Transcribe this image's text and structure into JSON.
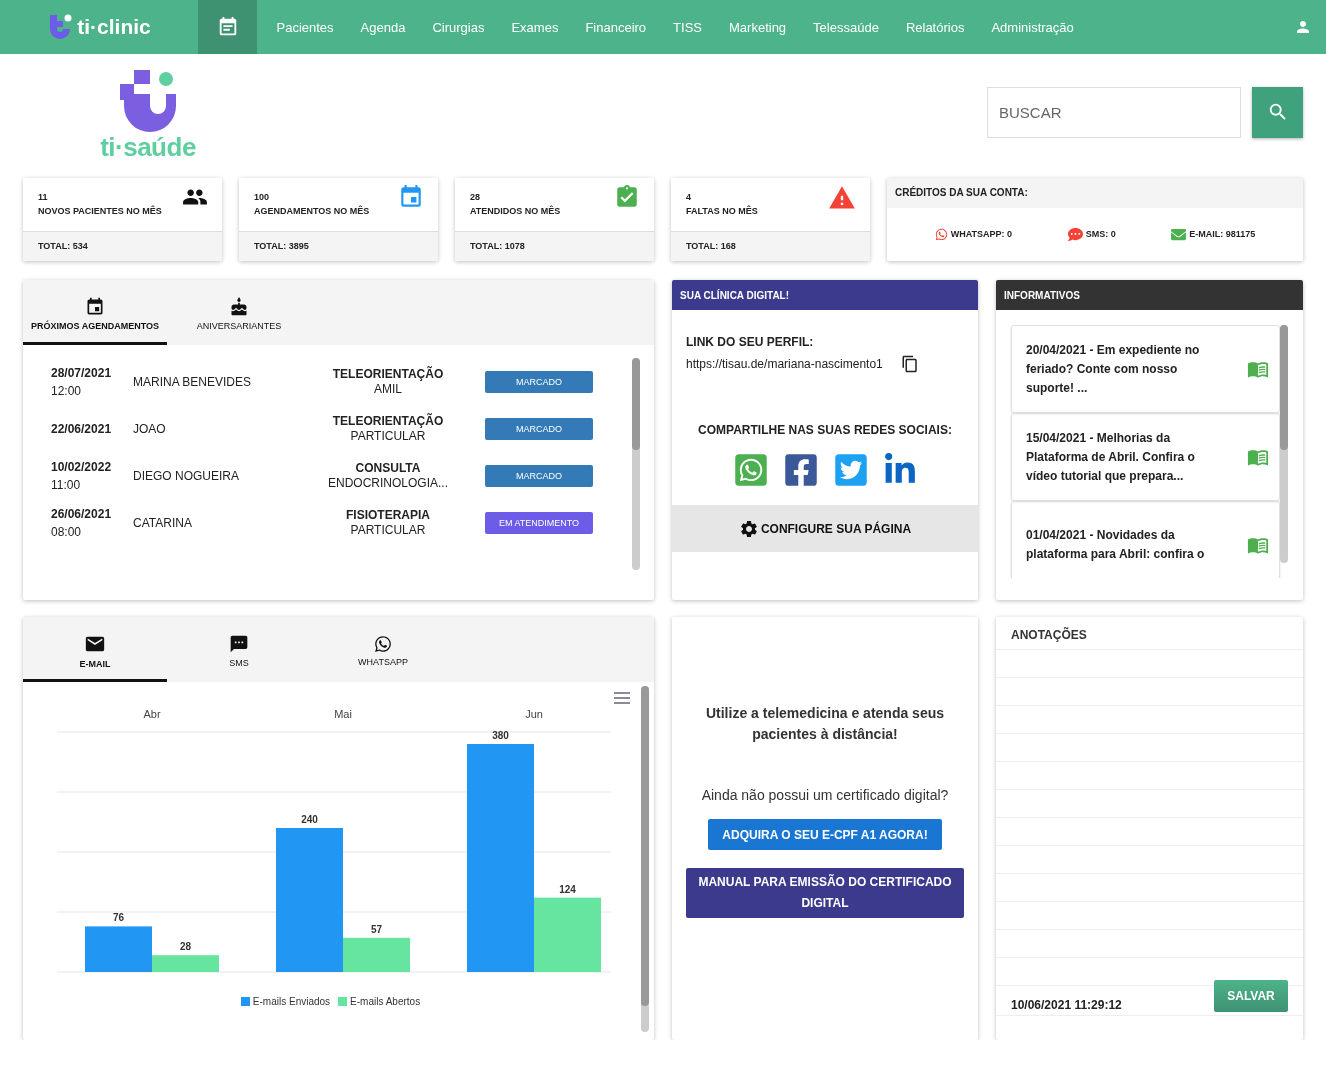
{
  "nav": {
    "brand": "ti·clinic",
    "calendar_selected": true,
    "items": [
      {
        "label": "Pacientes",
        "selected": false
      },
      {
        "label": "Agenda",
        "selected": false
      },
      {
        "label": "Cirurgias",
        "selected": false
      },
      {
        "label": "Exames",
        "selected": false
      },
      {
        "label": "Financeiro",
        "selected": false
      },
      {
        "label": "TISS",
        "selected": false
      },
      {
        "label": "Marketing",
        "selected": false
      },
      {
        "label": "Telessaúde",
        "selected": false
      },
      {
        "label": "Relatórios",
        "selected": false
      },
      {
        "label": "Administração",
        "selected": false
      }
    ]
  },
  "logo": {
    "text": "ti·saúde"
  },
  "search": {
    "placeholder": "BUSCAR"
  },
  "stats": [
    {
      "kind": "patients",
      "value": "11",
      "label": "NOVOS PACIENTES NO MÊS",
      "total": "TOTAL: 534"
    },
    {
      "kind": "appointments",
      "value": "100",
      "label": "AGENDAMENTOS NO MÊS",
      "total": "TOTAL: 3895"
    },
    {
      "kind": "attended",
      "value": "28",
      "label": "ATENDIDOS NO MÊS",
      "total": "TOTAL: 1078"
    },
    {
      "kind": "absences",
      "value": "4",
      "label": "FALTAS NO MÊS",
      "total": "TOTAL: 168"
    }
  ],
  "credits": {
    "title": "CRÉDITOS DA SUA CONTA:",
    "items": [
      {
        "kind": "whatsapp",
        "label": "WHATSAPP: 0"
      },
      {
        "kind": "sms",
        "label": "SMS: 0"
      },
      {
        "kind": "email",
        "label": "E-MAIL: 981175"
      }
    ]
  },
  "agenda": {
    "tabs": [
      {
        "kind": "calendar",
        "label": "PRÓXIMOS AGENDAMENTOS",
        "selected": true
      },
      {
        "kind": "cake",
        "label": "ANIVERSARIANTES",
        "selected": false
      }
    ],
    "rows": [
      {
        "date": "28/07/2021",
        "time": "12:00",
        "patient": "MARINA BENEVIDES",
        "procedure": "TELEORIENTAÇÃO",
        "insurance": "AMIL",
        "status": "MARCADO",
        "kind": "scheduled"
      },
      {
        "date": "22/06/2021",
        "patient": "JOAO",
        "procedure": "TELEORIENTAÇÃO",
        "insurance": "PARTICULAR",
        "status": "MARCADO",
        "kind": "scheduled"
      },
      {
        "date": "10/02/2022",
        "time": "11:00",
        "patient": "DIEGO NOGUEIRA",
        "procedure": "CONSULTA",
        "insurance": "ENDOCRINOLOGIA...",
        "status": "MARCADO",
        "kind": "scheduled"
      },
      {
        "date": "26/06/2021",
        "time": "08:00",
        "patient": "CATARINA",
        "procedure": "FISIOTERAPIA",
        "insurance": "PARTICULAR",
        "status": "EM ATENDIMENTO",
        "kind": "in_progress"
      }
    ]
  },
  "digital_clinic": {
    "title": "SUA CLÍNICA DIGITAL!",
    "link_label": "LINK DO SEU PERFIL:",
    "link": "https://tisau.de/mariana-nascimento1",
    "share_label": "COMPARTILHE NAS SUAS REDES SOCIAIS:",
    "configure": "CONFIGURE SUA PÁGINA"
  },
  "news": {
    "title": "INFORMATIVOS",
    "items": [
      {
        "text": "20/04/2021 - Em expediente no feriado? Conte com nosso suporte! ..."
      },
      {
        "text": "15/04/2021 - Melhorias da Plataforma de Abril. Confira o vídeo tutorial que prepara..."
      },
      {
        "text": "01/04/2021 - Novidades da plataforma para Abril: confira o"
      }
    ]
  },
  "messages": {
    "tabs": [
      {
        "kind": "email",
        "label": "E-MAIL",
        "selected": true
      },
      {
        "kind": "sms",
        "label": "SMS",
        "selected": false
      },
      {
        "kind": "whatsapp",
        "label": "WHATSAPP",
        "selected": false
      }
    ],
    "chart_data": {
      "type": "bar",
      "categories": [
        "Abr",
        "Mai",
        "Jun"
      ],
      "ylim": [
        0,
        400
      ],
      "data_labels": true,
      "series": [
        {
          "name": "E-mails Enviados",
          "color": "#2196f3",
          "values": [
            76,
            240,
            380
          ]
        },
        {
          "name": "E-mails Abertos",
          "color": "#66e5a0",
          "values": [
            28,
            57,
            124
          ]
        }
      ]
    }
  },
  "telemedicine": {
    "headline": "Utilize a telemedicina e atenda seus pacientes à distância!",
    "question": "Ainda não possui um certificado digital?",
    "buy_button": "ADQUIRA O SEU E-CPF A1 AGORA!",
    "manual_button": "MANUAL PARA EMISSÃO DO CERTIFICADO DIGITAL"
  },
  "notes": {
    "title": "ANOTAÇÕES",
    "date": "10/06/2021 11:29:12",
    "save": "SALVAR"
  }
}
